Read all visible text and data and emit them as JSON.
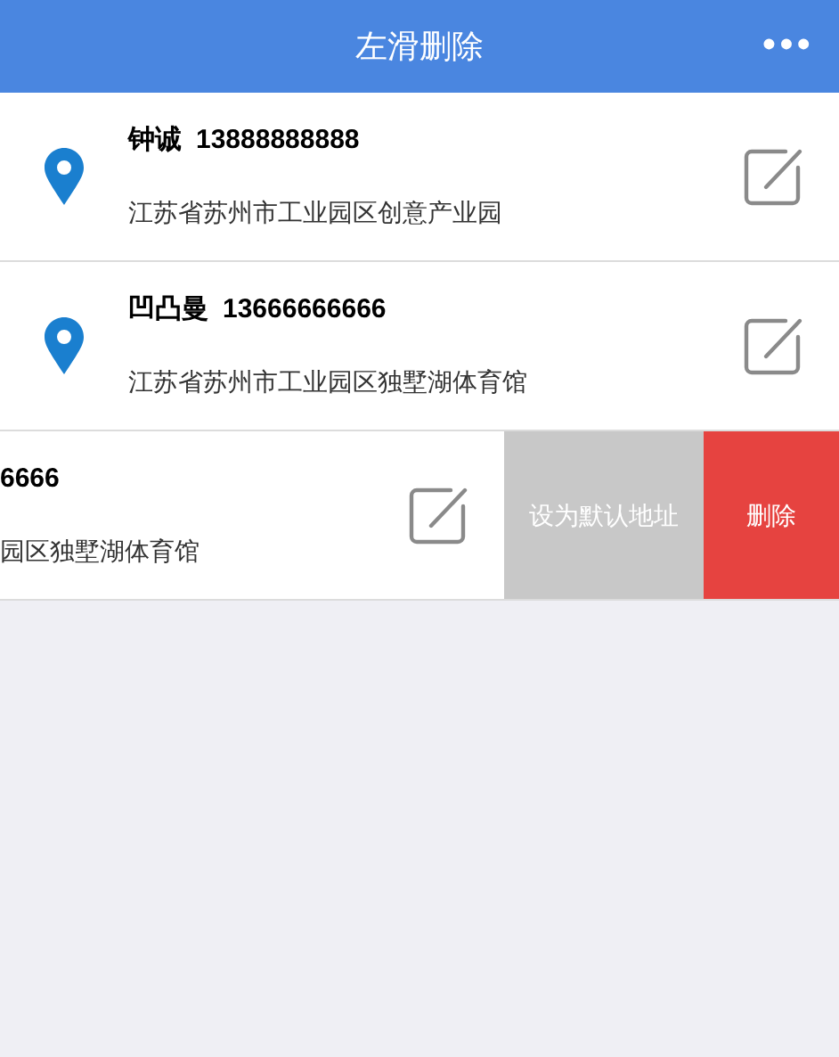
{
  "header": {
    "title": "左滑删除",
    "menu": "•••"
  },
  "addresses": [
    {
      "kind": "normal",
      "name": "钟诚",
      "phone": "13888888888",
      "address": "江苏省苏州市工业园区创意产业园"
    },
    {
      "kind": "normal",
      "name": "凹凸曼",
      "phone": "13666666666",
      "address": "江苏省苏州市工业园区独墅湖体育馆"
    },
    {
      "kind": "swiped",
      "phone": "6666",
      "address": "园区独墅湖体育馆",
      "actions": [
        {
          "kind": "default",
          "label": "设为默认地址"
        },
        {
          "kind": "delete",
          "label": "删除"
        }
      ]
    }
  ]
}
